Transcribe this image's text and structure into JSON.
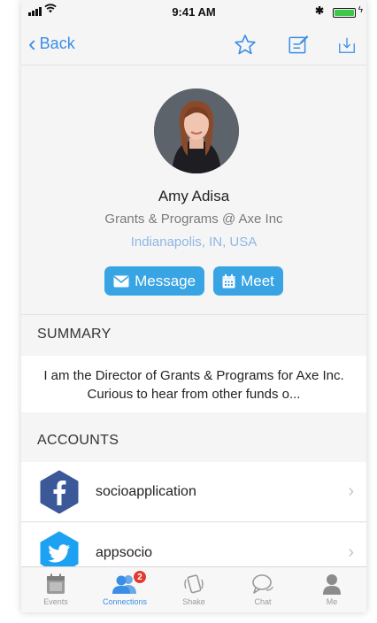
{
  "status_bar": {
    "time": "9:41 AM"
  },
  "navbar": {
    "back_label": "Back"
  },
  "profile": {
    "name": "Amy Adisa",
    "title": "Grants & Programs @ Axe Inc",
    "location": "Indianapolis, IN, USA",
    "message_label": "Message",
    "meet_label": "Meet"
  },
  "summary": {
    "header": "SUMMARY",
    "text": "I am the Director of Grants & Programs for Axe Inc. Curious to hear from other funds o..."
  },
  "accounts": {
    "header": "ACCOUNTS",
    "items": [
      {
        "name": "socioapplication",
        "icon": "facebook-icon"
      },
      {
        "name": "appsocio",
        "icon": "twitter-icon"
      }
    ]
  },
  "tabbar": {
    "tabs": [
      {
        "label": "Events",
        "icon": "calendar-icon"
      },
      {
        "label": "Connections",
        "icon": "people-icon",
        "badge": "2",
        "active": true
      },
      {
        "label": "Shake",
        "icon": "shake-icon"
      },
      {
        "label": "Chat",
        "icon": "chat-icon"
      },
      {
        "label": "Me",
        "icon": "person-icon"
      }
    ]
  },
  "colors": {
    "accent": "#3a8ee6",
    "button": "#39a4e4",
    "location": "#8fb7e3",
    "facebook": "#3b5998",
    "twitter": "#1da1f2",
    "badge": "#e23a2e"
  }
}
